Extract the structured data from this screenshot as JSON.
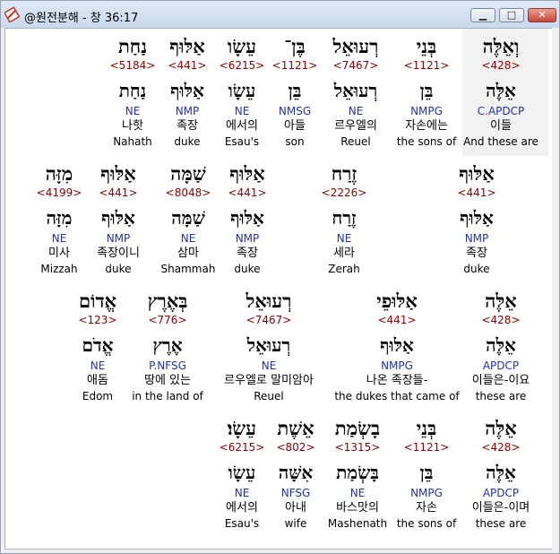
{
  "window": {
    "title": "@원전분해 - 창 36:17",
    "minimize_label": "▁",
    "maximize_label": "□",
    "close_label": "✕"
  },
  "rows": [
    {
      "words": [
        {
          "heb": "וְאֵלֶּה",
          "num": "<428>",
          "heb_lemma": "אֵלֶּה",
          "morph": "C.APDCP",
          "ko": "이들",
          "en": "And these are"
        },
        {
          "heb": "בְּנֵי",
          "num": "<1121>",
          "heb_lemma": "בֵּן",
          "morph": "NMPG",
          "ko": "자손에는",
          "en": "the sons of"
        },
        {
          "heb": "רְעוּאֵל",
          "num": "<7467>",
          "heb_lemma": "רְעוּאֵל",
          "morph": "NE",
          "ko": "르우엘의",
          "en": "Reuel"
        },
        {
          "heb": "בֶּן־",
          "num": "<1121>",
          "heb_lemma": "בֵּן",
          "morph": "NMSG",
          "ko": "아들",
          "en": "son"
        },
        {
          "heb": "עֵשָׂו",
          "num": "<6215>",
          "heb_lemma": "עֵשָׂו",
          "morph": "NE",
          "ko": "에서의",
          "en": "Esau's"
        },
        {
          "heb": "אַלּוּף",
          "num": "<441>",
          "heb_lemma": "אַלּוּף",
          "morph": "NMP",
          "ko": "족장",
          "en": "duke"
        },
        {
          "heb": "נַחַת",
          "num": "<5184>",
          "heb_lemma": "נַחַת",
          "morph": "NE",
          "ko": "나핫",
          "en": "Nahath"
        }
      ]
    },
    {
      "words": [
        {
          "heb": "אַלּוּף",
          "num": "<441>",
          "heb_lemma": "אַלּוּף",
          "morph": "NMP",
          "ko": "족장",
          "en": "duke"
        },
        {
          "heb": "זֶרַח",
          "num": "<2226>",
          "heb_lemma": "זֶרַח",
          "morph": "NE",
          "ko": "세라",
          "en": "Zerah"
        },
        {
          "heb": "אַלּוּף",
          "num": "<441>",
          "heb_lemma": "אַלּוּף",
          "morph": "NMP",
          "ko": "족장",
          "en": "duke"
        },
        {
          "heb": "שַׁמָּה",
          "num": "<8048>",
          "heb_lemma": "שַׁמָּה",
          "morph": "NE",
          "ko": "삼마",
          "en": "Shammah"
        },
        {
          "heb": "אַלּוּף",
          "num": "<441>",
          "heb_lemma": "אַלּוּף",
          "morph": "NMP",
          "ko": "족장이니",
          "en": "duke"
        },
        {
          "heb": "מִזָּה",
          "num": "<4199>",
          "heb_lemma": "מִזָּה",
          "morph": "NE",
          "ko": "미사",
          "en": "Mizzah"
        }
      ]
    },
    {
      "words": [
        {
          "heb": "אֵלֶּה",
          "num": "<428>",
          "heb_lemma": "אֵלֶּה",
          "morph": "APDCP",
          "ko": "이들은-이요",
          "en": "these are"
        },
        {
          "heb": "אַלּוּפֵי",
          "num": "<441>",
          "heb_lemma": "אַלּוּף",
          "morph": "NMPG",
          "ko": "나온 족장들-",
          "en": "the dukes that came of"
        },
        {
          "heb": "רְעוּאֵל",
          "num": "<7467>",
          "heb_lemma": "רְעוּאֵל",
          "morph": "NE",
          "ko": "르우엘로 말미암아",
          "en": "Reuel"
        },
        {
          "heb": "בְּאֶרֶץ",
          "num": "<776>",
          "heb_lemma": "אֶרֶץ",
          "morph": "P.NFSG",
          "ko": "땅에 있는",
          "en": "in the land of"
        },
        {
          "heb": "אֱדוֹם",
          "num": "<123>",
          "heb_lemma": "אֱדֹם",
          "morph": "NE",
          "ko": "애돔",
          "en": "Edom"
        }
      ]
    },
    {
      "words": [
        {
          "heb": "אֵלֶּה",
          "num": "<428>",
          "heb_lemma": "אֵלֶּה",
          "morph": "APDCP",
          "ko": "이들은-이며",
          "en": "these are"
        },
        {
          "heb": "בְּנֵי",
          "num": "<1121>",
          "heb_lemma": "בֵּן",
          "morph": "NMPG",
          "ko": "자손",
          "en": "the sons of"
        },
        {
          "heb": "בָשְׂמַת",
          "num": "<1315>",
          "heb_lemma": "בָּשְׂמַת",
          "morph": "NE",
          "ko": "바스맛의",
          "en": "Mashenath"
        },
        {
          "heb": "אֵשֶׁת",
          "num": "<802>",
          "heb_lemma": "אִשָּׁה",
          "morph": "NFSG",
          "ko": "아내",
          "en": "wife"
        },
        {
          "heb": "עֵשָׂו׃",
          "num": "<6215>",
          "heb_lemma": "עֵשָׂו",
          "morph": "NE",
          "ko": "에서의",
          "en": "Esau's"
        }
      ]
    }
  ]
}
